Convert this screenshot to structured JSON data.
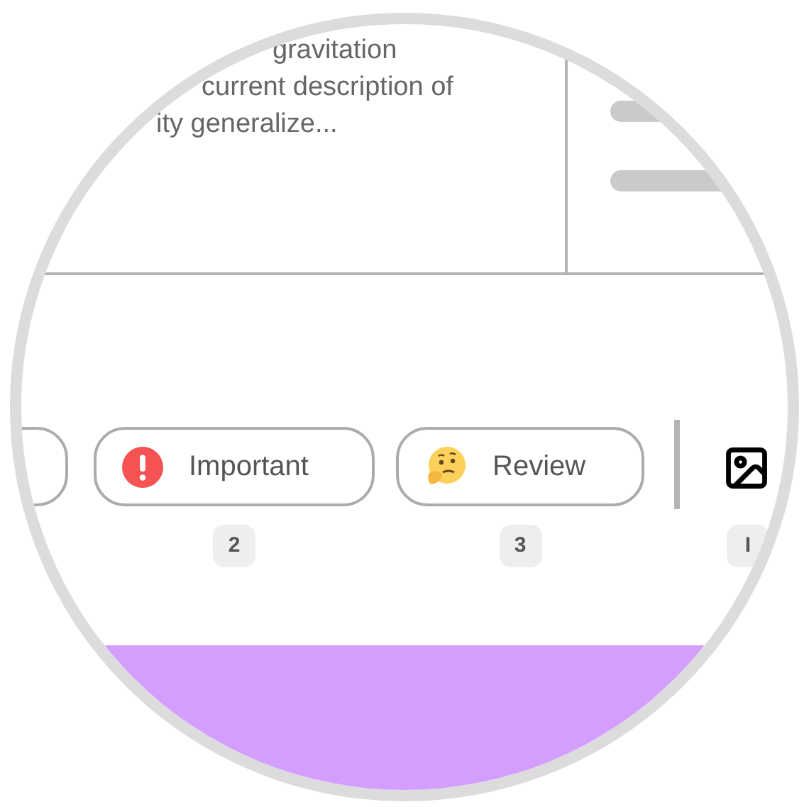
{
  "note": {
    "lines": [
      "gravitation",
      "current description of",
      "ity generalize..."
    ]
  },
  "tags": [
    {
      "kind": "blank"
    },
    {
      "kind": "alert",
      "label": "Important",
      "badge": "2"
    },
    {
      "kind": "thinking",
      "label": "Review",
      "badge": "3"
    }
  ],
  "image_tool": {
    "badge": "I"
  }
}
